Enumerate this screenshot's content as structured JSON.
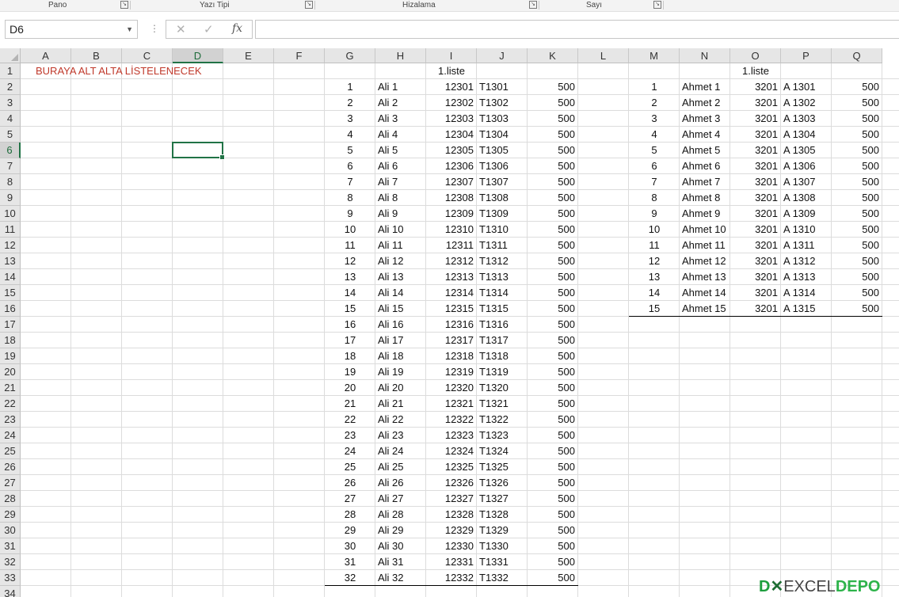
{
  "ribbon": {
    "groups": [
      "Pano",
      "Yazı Tipi",
      "Hizalama",
      "Sayı"
    ]
  },
  "formula_bar": {
    "name_box": "D6",
    "cancel_icon": "✕",
    "enter_icon": "✓",
    "fx_label": "fx",
    "formula": ""
  },
  "columns": [
    "A",
    "B",
    "C",
    "D",
    "E",
    "F",
    "G",
    "H",
    "I",
    "J",
    "K",
    "L",
    "M",
    "N",
    "O",
    "P",
    "Q"
  ],
  "rows": [
    "1",
    "2",
    "3",
    "4",
    "5",
    "6",
    "7",
    "8",
    "9",
    "10",
    "11",
    "12",
    "13",
    "14",
    "15",
    "16",
    "17",
    "18",
    "19",
    "20",
    "21",
    "22",
    "23",
    "24",
    "25",
    "26",
    "27",
    "28",
    "29",
    "30",
    "31",
    "32",
    "33",
    "34"
  ],
  "selected": {
    "cell": "D6",
    "column": "D",
    "row": "6"
  },
  "note": "BURAYA ALT ALTA LİSTELENECEK",
  "list1": {
    "title": "1.liste",
    "rows": [
      [
        "1",
        "Ali 1",
        "12301",
        "T1301",
        "500"
      ],
      [
        "2",
        "Ali 2",
        "12302",
        "T1302",
        "500"
      ],
      [
        "3",
        "Ali 3",
        "12303",
        "T1303",
        "500"
      ],
      [
        "4",
        "Ali 4",
        "12304",
        "T1304",
        "500"
      ],
      [
        "5",
        "Ali 5",
        "12305",
        "T1305",
        "500"
      ],
      [
        "6",
        "Ali 6",
        "12306",
        "T1306",
        "500"
      ],
      [
        "7",
        "Ali 7",
        "12307",
        "T1307",
        "500"
      ],
      [
        "8",
        "Ali 8",
        "12308",
        "T1308",
        "500"
      ],
      [
        "9",
        "Ali 9",
        "12309",
        "T1309",
        "500"
      ],
      [
        "10",
        "Ali 10",
        "12310",
        "T1310",
        "500"
      ],
      [
        "11",
        "Ali 11",
        "12311",
        "T1311",
        "500"
      ],
      [
        "12",
        "Ali 12",
        "12312",
        "T1312",
        "500"
      ],
      [
        "13",
        "Ali 13",
        "12313",
        "T1313",
        "500"
      ],
      [
        "14",
        "Ali 14",
        "12314",
        "T1314",
        "500"
      ],
      [
        "15",
        "Ali 15",
        "12315",
        "T1315",
        "500"
      ],
      [
        "16",
        "Ali 16",
        "12316",
        "T1316",
        "500"
      ],
      [
        "17",
        "Ali 17",
        "12317",
        "T1317",
        "500"
      ],
      [
        "18",
        "Ali 18",
        "12318",
        "T1318",
        "500"
      ],
      [
        "19",
        "Ali 19",
        "12319",
        "T1319",
        "500"
      ],
      [
        "20",
        "Ali 20",
        "12320",
        "T1320",
        "500"
      ],
      [
        "21",
        "Ali 21",
        "12321",
        "T1321",
        "500"
      ],
      [
        "22",
        "Ali 22",
        "12322",
        "T1322",
        "500"
      ],
      [
        "23",
        "Ali 23",
        "12323",
        "T1323",
        "500"
      ],
      [
        "24",
        "Ali 24",
        "12324",
        "T1324",
        "500"
      ],
      [
        "25",
        "Ali 25",
        "12325",
        "T1325",
        "500"
      ],
      [
        "26",
        "Ali 26",
        "12326",
        "T1326",
        "500"
      ],
      [
        "27",
        "Ali 27",
        "12327",
        "T1327",
        "500"
      ],
      [
        "28",
        "Ali 28",
        "12328",
        "T1328",
        "500"
      ],
      [
        "29",
        "Ali 29",
        "12329",
        "T1329",
        "500"
      ],
      [
        "30",
        "Ali 30",
        "12330",
        "T1330",
        "500"
      ],
      [
        "31",
        "Ali 31",
        "12331",
        "T1331",
        "500"
      ],
      [
        "32",
        "Ali 32",
        "12332",
        "T1332",
        "500"
      ]
    ]
  },
  "list2": {
    "title": "1.liste",
    "rows": [
      [
        "1",
        "Ahmet 1",
        "3201",
        "A 1301",
        "500"
      ],
      [
        "2",
        "Ahmet 2",
        "3201",
        "A 1302",
        "500"
      ],
      [
        "3",
        "Ahmet 3",
        "3201",
        "A 1303",
        "500"
      ],
      [
        "4",
        "Ahmet 4",
        "3201",
        "A 1304",
        "500"
      ],
      [
        "5",
        "Ahmet 5",
        "3201",
        "A 1305",
        "500"
      ],
      [
        "6",
        "Ahmet 6",
        "3201",
        "A 1306",
        "500"
      ],
      [
        "7",
        "Ahmet 7",
        "3201",
        "A 1307",
        "500"
      ],
      [
        "8",
        "Ahmet 8",
        "3201",
        "A 1308",
        "500"
      ],
      [
        "9",
        "Ahmet 9",
        "3201",
        "A 1309",
        "500"
      ],
      [
        "10",
        "Ahmet 10",
        "3201",
        "A 1310",
        "500"
      ],
      [
        "11",
        "Ahmet 11",
        "3201",
        "A 1311",
        "500"
      ],
      [
        "12",
        "Ahmet 12",
        "3201",
        "A 1312",
        "500"
      ],
      [
        "13",
        "Ahmet 13",
        "3201",
        "A 1313",
        "500"
      ],
      [
        "14",
        "Ahmet 14",
        "3201",
        "A 1314",
        "500"
      ],
      [
        "15",
        "Ahmet 15",
        "3201",
        "A 1315",
        "500"
      ]
    ]
  },
  "watermark": {
    "text": "EXCELDEPO"
  }
}
